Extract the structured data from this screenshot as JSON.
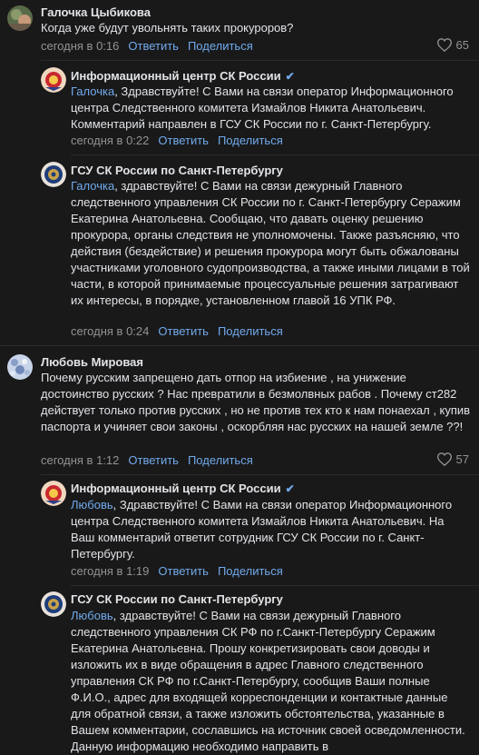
{
  "comments": [
    {
      "author": "Галочка Цыбикова",
      "text": "Когда уже будут увольнять таких прокуроров?",
      "time": "сегодня в 0:16",
      "reply_label": "Ответить",
      "share_label": "Поделиться",
      "likes": "65",
      "replies": [
        {
          "author": "Информационный центр СК России",
          "verified": true,
          "mention": "Галочка",
          "text": ", Здравствуйте! С Вами на связи оператор Информационного центра Следственного комитета Измайлов Никита Анатольевич. Комментарий направлен в ГСУ СК России по г. Санкт-Петербургу.",
          "time": "сегодня в 0:22",
          "reply_label": "Ответить",
          "share_label": "Поделиться"
        },
        {
          "author": "ГСУ СК России по Санкт-Петербургу",
          "verified": false,
          "mention": "Галочка",
          "text": ", здравствуйте! С Вами на связи дежурный Главного следственного управления СК России по г. Санкт-Петербургу Серажим Екатерина Анатольевна. Сообщаю, что давать оценку решению прокурора, органы следствия не уполномочены. Также разъясняю, что действия (бездействие) и решения прокурора могут быть обжалованы участниками уголовного судопроизводства, а также иными лицами в той части, в которой принимаемые процессуальные решения затрагивают их интересы, в порядке, установленном главой 16 УПК РФ.",
          "time": "сегодня в 0:24",
          "reply_label": "Ответить",
          "share_label": "Поделиться"
        }
      ]
    },
    {
      "author": "Любовь Мировая",
      "text": "Почему русским запрещено дать отпор на избиение , на унижение достоинство русских ? Нас превратили в безмолвных рабов . Почему ст282 действует только против русских , но не против тех кто к нам понаехал , купив паспорта и учиняет свои законы , оскорбляя нас русских на нашей земле ??!",
      "time": "сегодня в 1:12",
      "reply_label": "Ответить",
      "share_label": "Поделиться",
      "likes": "57",
      "replies": [
        {
          "author": "Информационный центр СК России",
          "verified": true,
          "mention": "Любовь",
          "text": ", Здравствуйте! С Вами на связи оператор Информационного центра Следственного комитета Измайлов Никита Анатольевич. На Ваш комментарий ответит сотрудник ГСУ СК России по г. Санкт-Петербургу.",
          "time": "сегодня в 1:19",
          "reply_label": "Ответить",
          "share_label": "Поделиться"
        },
        {
          "author": "ГСУ СК России по Санкт-Петербургу",
          "verified": false,
          "mention": "Любовь",
          "text": ", здравствуйте! С Вами на связи дежурный Главного следственного управления СК РФ по г.Санкт-Петербургу Серажим Екатерина Анатольевна. Прошу конкретизировать свои доводы и изложить их в виде обращения в адрес Главного следственного управления СК РФ по г.Санкт-Петербургу, сообщив Ваши полные Ф.И.О., адрес для входящей корреспонденции и контактные данные для обратной связи, а также изложить обстоятельства, указанные в Вашем комментарии, сославшись на источник своей осведомленности. Данную информацию необходимо направить в"
        }
      ]
    }
  ]
}
